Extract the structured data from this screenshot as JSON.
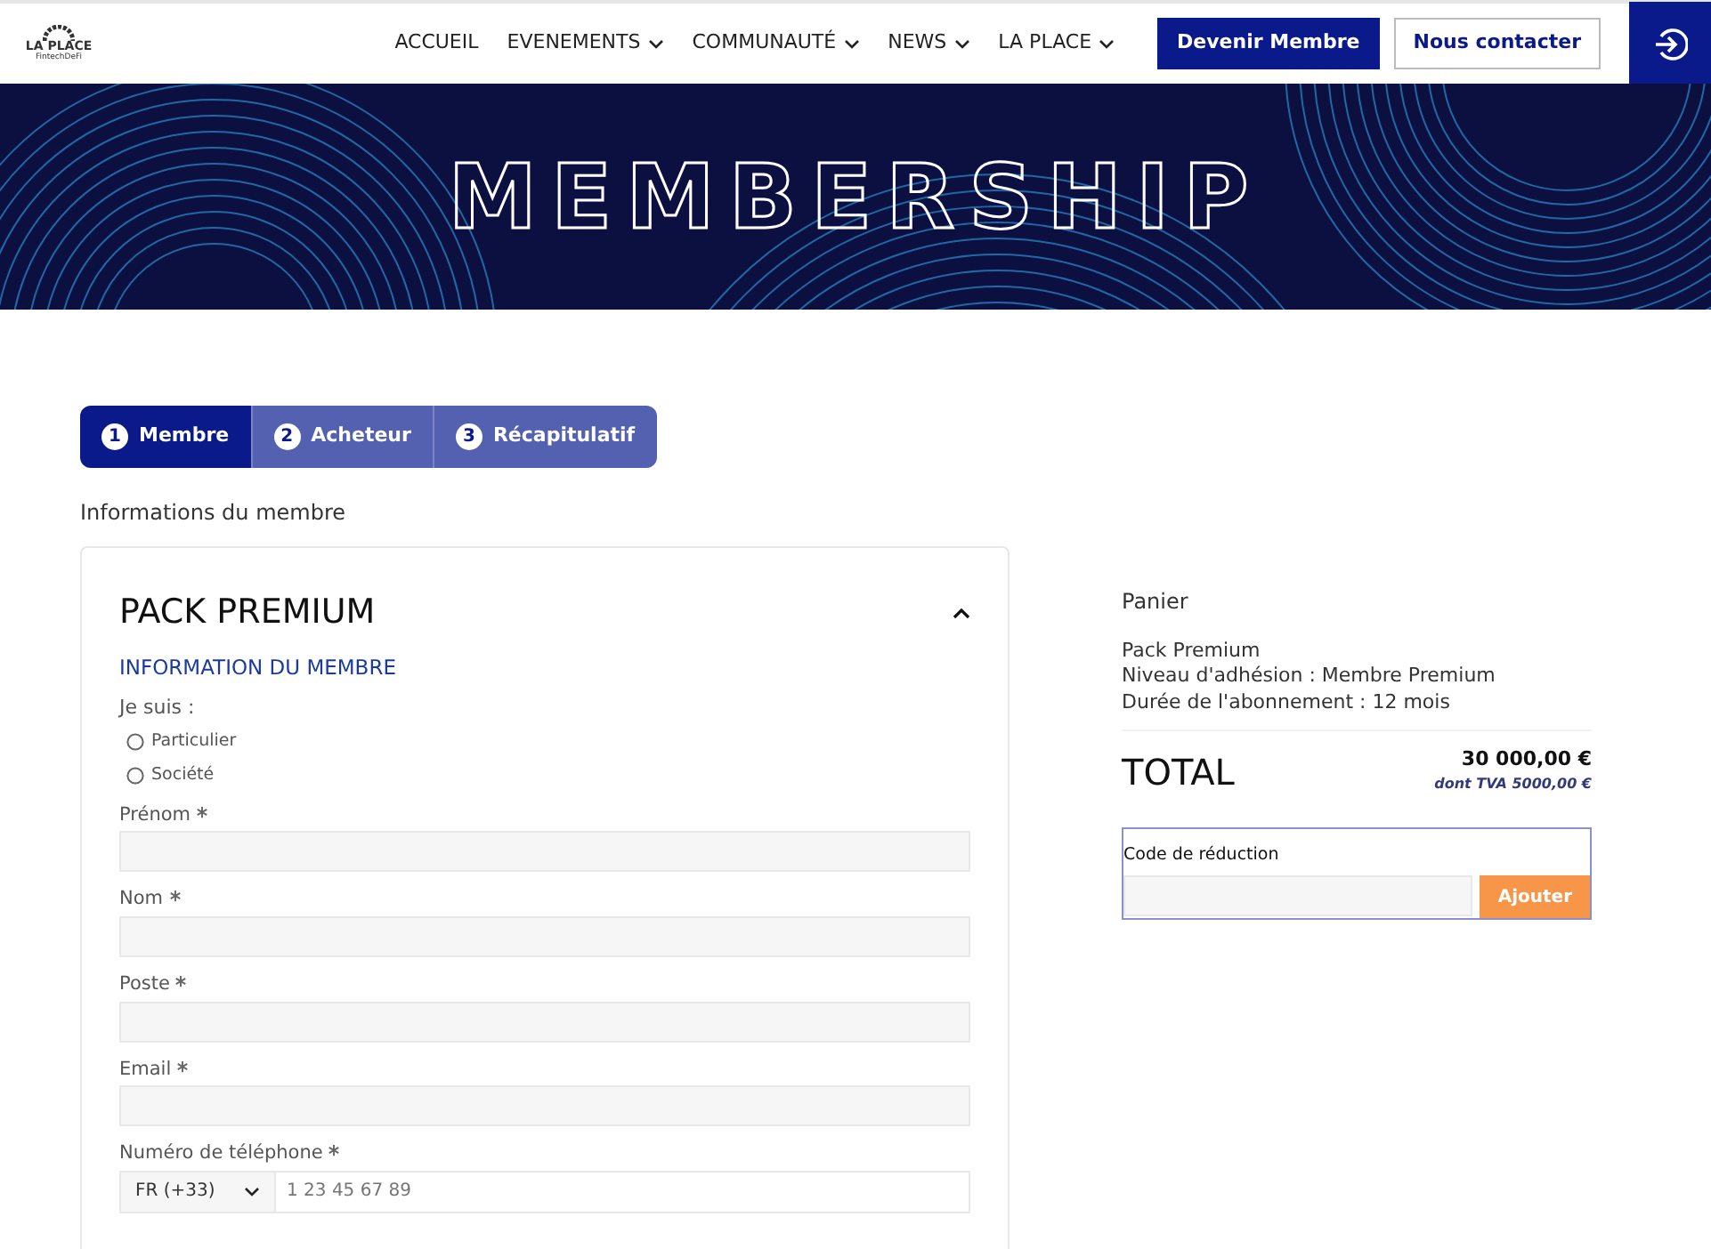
{
  "header": {
    "logo": {
      "name": "LA PLACE",
      "tagline": "FintechDeFi"
    },
    "nav": [
      {
        "label": "ACCUEIL",
        "dropdown": false
      },
      {
        "label": "EVENEMENTS",
        "dropdown": true
      },
      {
        "label": "COMMUNAUTÉ",
        "dropdown": true
      },
      {
        "label": "NEWS",
        "dropdown": true
      },
      {
        "label": "LA PLACE",
        "dropdown": true
      }
    ],
    "buttons": [
      {
        "label": "Devenir Membre",
        "kind": "primary"
      },
      {
        "label": "Nous contacter",
        "kind": "outline"
      }
    ]
  },
  "banner": {
    "title": "MEMBERSHIP"
  },
  "steps": [
    {
      "number": "1",
      "label": "Membre",
      "selected": true
    },
    {
      "number": "2",
      "label": "Acheteur",
      "selected": false
    },
    {
      "number": "3",
      "label": "Récapitulatif",
      "selected": false
    }
  ],
  "section_title": "Informations du membre",
  "form": {
    "title": "PACK PREMIUM",
    "expanded": true,
    "subtitle": "INFORMATION DU MEMBRE",
    "radio_label": "Je suis :",
    "radios": [
      {
        "label": "Particulier",
        "selected": false
      },
      {
        "label": "Société",
        "selected": false
      }
    ],
    "fields": [
      {
        "label": "Prénom",
        "required": true
      },
      {
        "label": "Nom",
        "required": true
      },
      {
        "label": "Poste",
        "required": true
      },
      {
        "label": "Email",
        "required": true
      }
    ],
    "phone": {
      "label": "Numéro de téléphone",
      "required": true,
      "country": "FR (+33)",
      "placeholder": "1 23 45 67 89"
    }
  },
  "cart": {
    "title": "Panier",
    "lines": [
      "Pack Premium",
      "Niveau d'adhésion : Membre Premium",
      "Durée de l'abonnement : 12 mois"
    ],
    "total_label": "TOTAL",
    "total": "30 000,00 €",
    "vat": "dont TVA 5000,00 €",
    "discount": {
      "label": "Code de réduction",
      "button": "Ajouter"
    }
  }
}
